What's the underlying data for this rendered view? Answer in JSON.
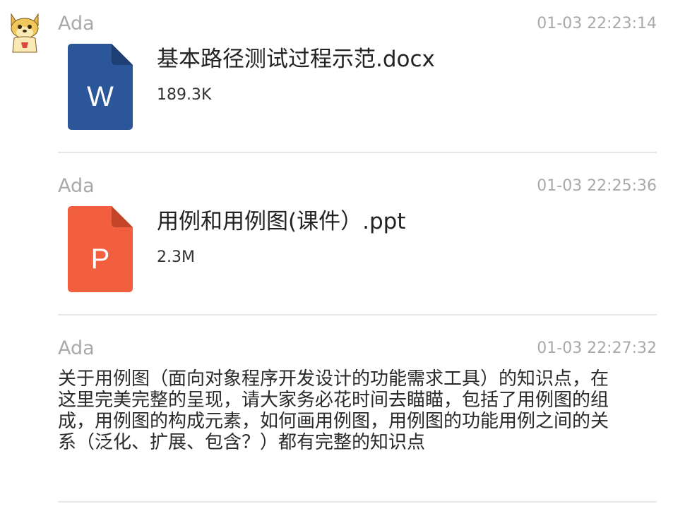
{
  "messages": [
    {
      "sender": "Ada",
      "time": "01-03 22:23:14",
      "type": "file",
      "file": {
        "name": "基本路径测试过程示范.docx",
        "size": "189.3K",
        "icon": "word-file-icon",
        "icon_letter": "W",
        "color": "#2b579a"
      }
    },
    {
      "sender": "Ada",
      "time": "01-03 22:25:36",
      "type": "file",
      "file": {
        "name": "用例和用例图(课件）.ppt",
        "size": "2.3M",
        "icon": "powerpoint-file-icon",
        "icon_letter": "P",
        "color": "#f25f3e"
      }
    },
    {
      "sender": "Ada",
      "time": "01-03 22:27:32",
      "type": "text",
      "text": "关于用例图（面向对象程序开发设计的功能需求工具）的知识点，在这里完美完整的呈现，请大家务必花时间去瞄瞄，包括了用例图的组成，用例图的构成元素，如何画用例图，用例图的功能用例之间的关系（泛化、扩展、包含？）都有完整的知识点"
    }
  ]
}
